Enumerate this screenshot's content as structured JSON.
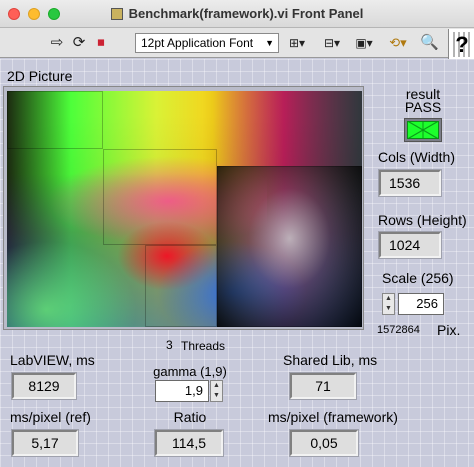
{
  "window": {
    "title": "Benchmark(framework).vi Front Panel"
  },
  "toolbar": {
    "font_select": "12pt Application Font",
    "help_glyph": "?"
  },
  "panel": {
    "picture_label": "2D Picture",
    "result_label_1": "result",
    "result_label_2": "PASS",
    "result_led_color": "#1dff2c",
    "cols_label": "Cols (Width)",
    "cols_value": "1536",
    "rows_label": "Rows (Height)",
    "rows_value": "1024",
    "scale_label": "Scale (256)",
    "scale_value": "256",
    "pixels_value": "1572864",
    "pixels_label": "Pix.",
    "threads_value": "3",
    "threads_label": "Threads",
    "labview_label": "LabVIEW, ms",
    "labview_value": "8129",
    "gamma_label": "gamma (1,9)",
    "gamma_value": "1,9",
    "shared_label": "Shared Lib, ms",
    "shared_value": "71",
    "ms_ref_label": "ms/pixel (ref)",
    "ms_ref_value": "5,17",
    "ratio_label": "Ratio",
    "ratio_value": "114,5",
    "ms_fw_label": "ms/pixel (framework)",
    "ms_fw_value": "0,05"
  }
}
